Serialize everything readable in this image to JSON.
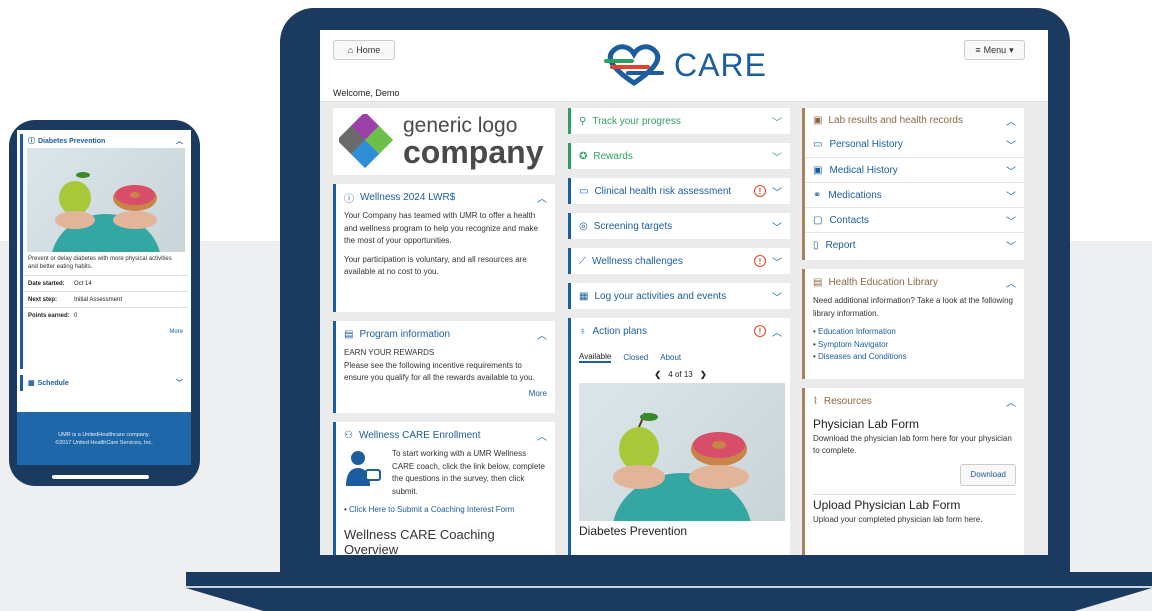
{
  "brand": {
    "name": "CARE",
    "colors": {
      "navy": "#1b3a5f",
      "blue": "#1b5d9e",
      "green": "#2e9e62",
      "tan": "#a7845b",
      "alert": "#e2412c"
    }
  },
  "header": {
    "home_label": "Home",
    "menu_label": "Menu",
    "welcome": "Welcome, Demo"
  },
  "col1": {
    "company_logo": {
      "line1": "generic logo",
      "line2": "company"
    },
    "wellness": {
      "title": "Wellness 2024 LWR$",
      "p1": "Your Company has teamed with UMR to offer a health and wellness program to help you recognize and make the most of your opportunities.",
      "p2": "Your participation is voluntary, and all resources are available at no cost to you."
    },
    "program": {
      "title": "Program information",
      "heading": "EARN YOUR REWARDS",
      "body": "Please see the following incentive requirements to ensure you qualify for all the rewards available to you.",
      "more": "More"
    },
    "enrollment": {
      "title": "Wellness CARE Enrollment",
      "body": "To start working with a UMR Wellness CARE coach, click the link below, complete the questions in the survey, then click submit.",
      "link": "Click Here to Submit a Coaching Interest Form",
      "overview": "Wellness CARE Coaching Overview"
    }
  },
  "col2": {
    "items": [
      {
        "label": "Track your progress",
        "icon": "search-icon"
      },
      {
        "label": "Rewards",
        "icon": "star-icon"
      },
      {
        "label": "Clinical health risk assessment",
        "icon": "clipboard-icon",
        "alert": "!"
      },
      {
        "label": "Screening targets",
        "icon": "target-icon"
      },
      {
        "label": "Wellness challenges",
        "icon": "chart-line-icon",
        "alert": "!"
      },
      {
        "label": "Log your activities and events",
        "icon": "calendar-icon"
      }
    ],
    "action_plans": {
      "title": "Action plans",
      "alert": "!",
      "tabs": [
        "Available",
        "Closed",
        "About"
      ],
      "pager": "4 of 13",
      "plan_title": "Diabetes Prevention"
    }
  },
  "col3": {
    "lab": {
      "title": "Lab results and health records",
      "rows": [
        "Personal History",
        "Medical History",
        "Medications",
        "Contacts",
        "Report"
      ]
    },
    "library": {
      "title": "Health Education Library",
      "intro": "Need additional information? Take a look at the following library information.",
      "links": [
        "Education Information",
        "Symptom Navigator",
        "Diseases and Conditions"
      ]
    },
    "resources": {
      "title": "Resources",
      "form1_title": "Physician Lab Form",
      "form1_body": "Download the physician lab form here for your physician to complete.",
      "download": "Download",
      "form2_title": "Upload Physician Lab Form",
      "form2_body": "Upload your completed physician lab form here."
    }
  },
  "phone": {
    "card_title": "Diabetes Prevention",
    "desc": "Prevent or delay diabetes with more physical activities and better eating habits.",
    "rows": [
      {
        "k": "Date started:",
        "v": "Oct 14"
      },
      {
        "k": "Next step:",
        "v": "Initial Assessment"
      },
      {
        "k": "Points earned:",
        "v": "0"
      }
    ],
    "more": "More",
    "schedule": "Schedule",
    "footer1": "UMR is a UnitedHealthcare company.",
    "footer2": "©2017 United HealthCare Services, Inc."
  }
}
